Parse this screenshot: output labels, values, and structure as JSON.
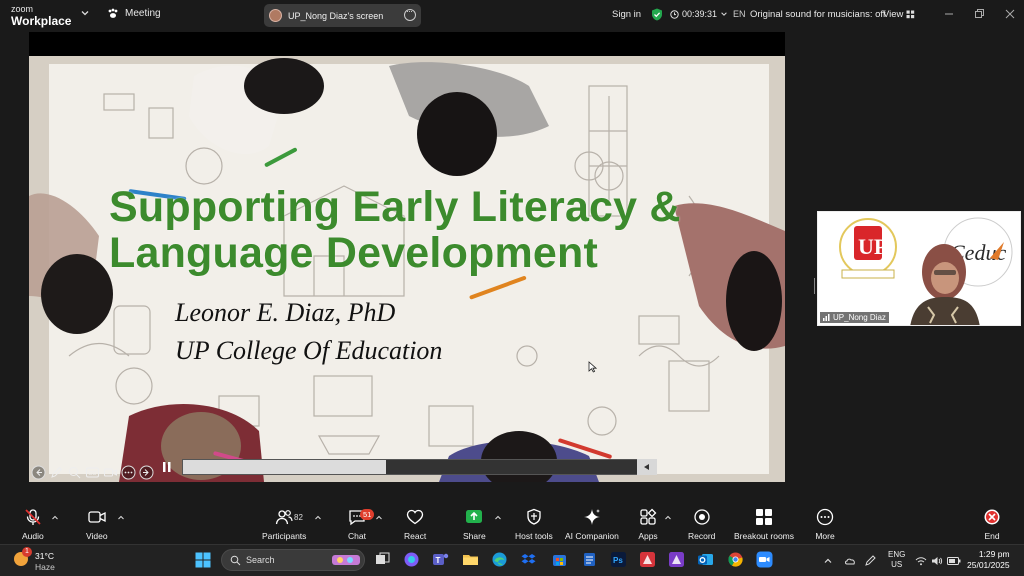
{
  "app": {
    "brand_small": "zoom",
    "brand_big": "Workplace",
    "meeting_label": "Meeting"
  },
  "topbar": {
    "share_label": "UP_Nong Diaz's screen",
    "signin": "Sign in",
    "timer": "00:39:31",
    "lang": "EN",
    "original_sound": "Original sound for musicians: off",
    "view": "View"
  },
  "slide": {
    "title_line1": "Supporting Early Literacy &",
    "title_line2": "Language Development",
    "author": "Leonor E. Diaz, PhD",
    "org": "UP College Of Education",
    "progress_fraction": 0.43,
    "colors": {
      "title": "#3c8b2d",
      "subtitle": "#111111"
    }
  },
  "thumbnail": {
    "name": "UP_Nong Diaz"
  },
  "toolbar": {
    "audio": "Audio",
    "video": "Video",
    "participants": "Participants",
    "participants_count": "82",
    "chat": "Chat",
    "chat_badge": "51",
    "react": "React",
    "share": "Share",
    "host_tools": "Host tools",
    "ai_companion": "AI Companion",
    "apps": "Apps",
    "record": "Record",
    "breakout": "Breakout rooms",
    "more": "More",
    "end": "End",
    "colors": {
      "share_green": "#22b14c",
      "end_red": "#e0312f",
      "mute_red": "#e0312f"
    }
  },
  "taskbar": {
    "weather_alert": "1",
    "temperature": "31°C",
    "weather": "Haze",
    "search_placeholder": "Search",
    "lang_line1": "ENG",
    "lang_line2": "US",
    "time": "1:29 pm",
    "date": "25/01/2025"
  }
}
